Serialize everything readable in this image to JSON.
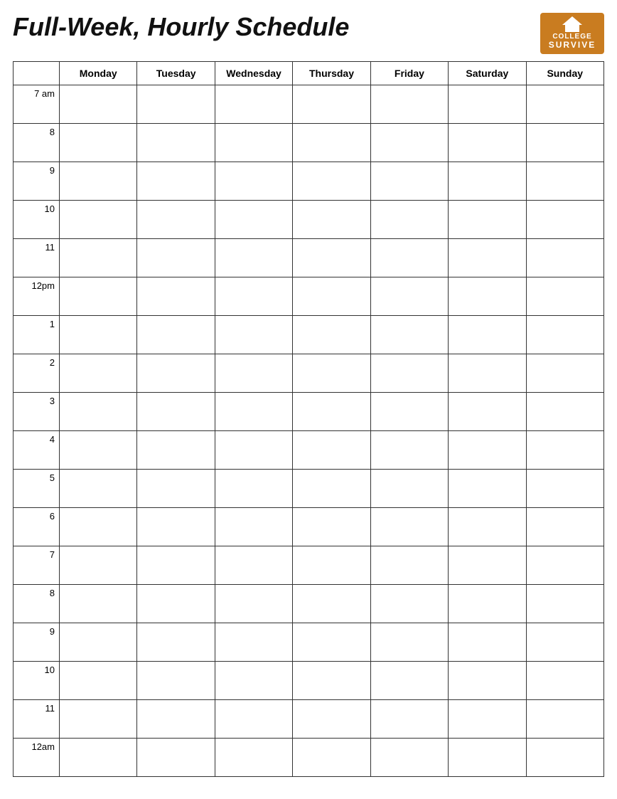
{
  "header": {
    "title": "Full-Week, Hourly Schedule",
    "logo": {
      "line1": "COLLEGE",
      "line2": "SURVIVE"
    }
  },
  "days": [
    "Monday",
    "Tuesday",
    "Wednesday",
    "Thursday",
    "Friday",
    "Saturday",
    "Sunday"
  ],
  "time_slots": [
    "7 am",
    "8",
    "9",
    "10",
    "11",
    "12pm",
    "1",
    "2",
    "3",
    "4",
    "5",
    "6",
    "7",
    "8",
    "9",
    "10",
    "11",
    "12am"
  ]
}
